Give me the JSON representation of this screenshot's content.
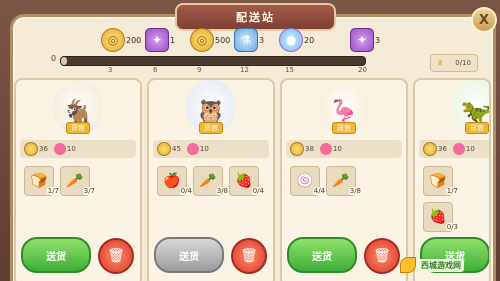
{
  "header": {
    "title": "配送站",
    "close": "X"
  },
  "progress": {
    "start_value": "0",
    "fill_fraction": 0.02,
    "ticks": [
      "3",
      "6",
      "9",
      "12",
      "15",
      "20"
    ],
    "milestones": [
      {
        "icon": "coin-icon",
        "count": "200"
      },
      {
        "icon": "gift-icon",
        "count": "1"
      },
      {
        "icon": "coin-icon",
        "count": "500"
      },
      {
        "icon": "bottle-icon",
        "count": "3"
      },
      {
        "icon": "orb-icon",
        "count": "20"
      },
      {
        "icon": "gift-icon",
        "count": "3"
      }
    ],
    "reward_box": "0/10"
  },
  "cards": [
    {
      "name": "货官",
      "coins": "36",
      "hearts": "10",
      "ship_label": "送货",
      "ship_enabled": true,
      "items": [
        {
          "icon": "bread-icon",
          "qty": "1/7"
        },
        {
          "icon": "carrot-icon",
          "qty": "3/7"
        }
      ]
    },
    {
      "name": "货官",
      "coins": "45",
      "hearts": "10",
      "ship_label": "送货",
      "ship_enabled": false,
      "items": [
        {
          "icon": "apple-icon",
          "qty": "0/4"
        },
        {
          "icon": "carrot-icon",
          "qty": "3/8"
        },
        {
          "icon": "strawberry-icon",
          "qty": "0/4"
        }
      ]
    },
    {
      "name": "货官",
      "coins": "38",
      "hearts": "10",
      "ship_label": "送货",
      "ship_enabled": true,
      "items": [
        {
          "icon": "cake-roll-icon",
          "qty": "4/4"
        },
        {
          "icon": "carrot-icon",
          "qty": "3/8"
        }
      ]
    },
    {
      "name": "货官",
      "coins": "36",
      "hearts": "10",
      "ship_label": "送货",
      "ship_enabled": true,
      "items": [
        {
          "icon": "bread-icon",
          "qty": "1/7"
        },
        {
          "icon": "strawberry-icon",
          "qty": "0/3"
        }
      ]
    }
  ],
  "watermark": {
    "text": "西城游戏网"
  }
}
